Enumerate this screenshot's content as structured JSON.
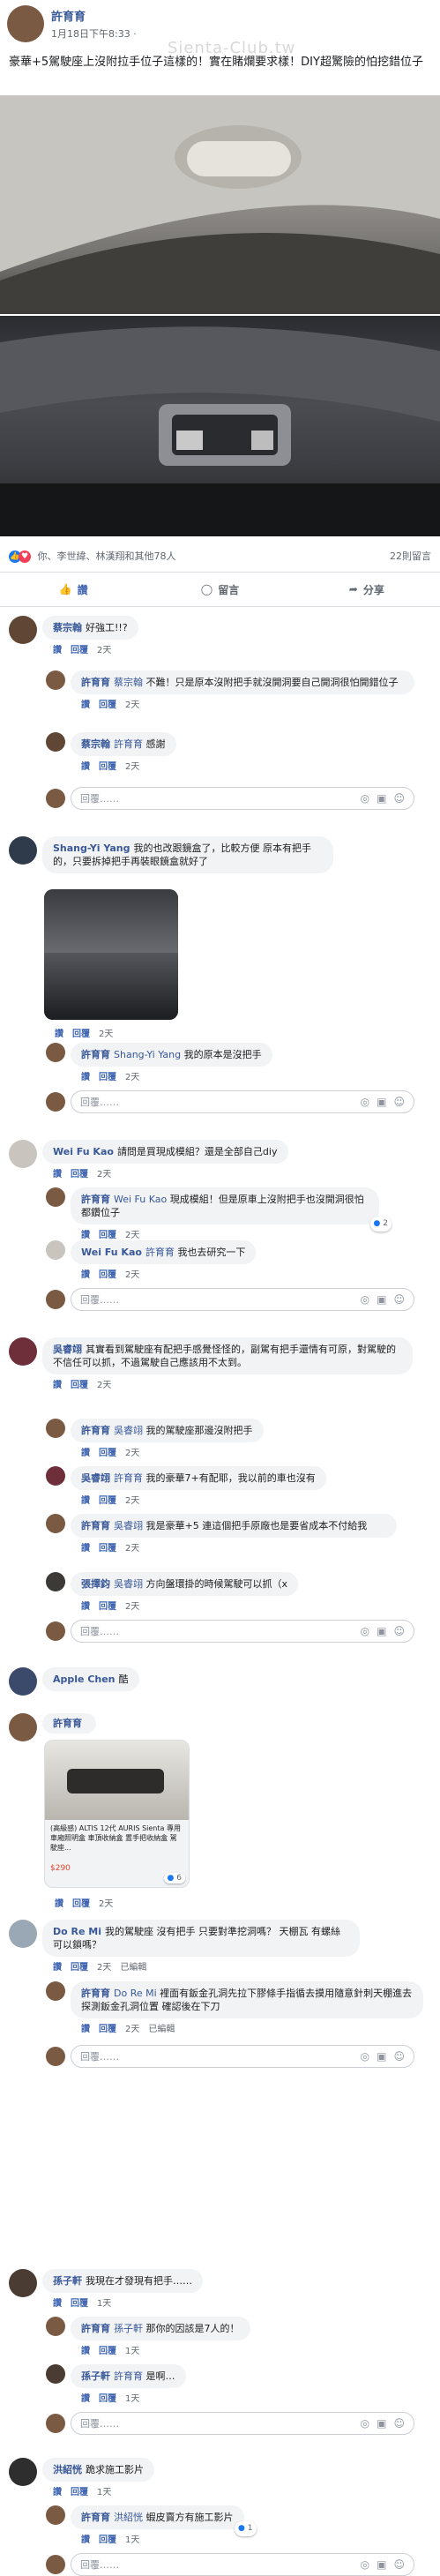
{
  "post": {
    "author": "許育育",
    "time": "1月18日下午8:33",
    "watermark": "Sienta-Club.tw",
    "text": "豪華+5駕駛座上沒附拉手位子這樣的！實在賭爛要求樣！DIY超驚險的怕挖錯位子"
  },
  "reactions": {
    "summary": "你、李世緯、林漢翔和其他78人",
    "comment_count": "22則留言"
  },
  "actions": {
    "like": "讚",
    "comment": "留言",
    "share": "分享"
  },
  "reply_placeholder": "回覆……",
  "comments": {
    "c1": {
      "name": "蔡宗翰",
      "text": "好強工!!?",
      "like": "讚",
      "reply": "回覆",
      "time": "2天",
      "r1": {
        "name": "許育育",
        "mention": "蔡宗翰",
        "text": "不難！只是原本沒附把手就沒開洞要自己開洞很怕開錯位子",
        "time": "2天"
      },
      "r2": {
        "name": "蔡宗翰",
        "mention": "許育育",
        "text": "感謝",
        "time": "2天"
      }
    },
    "c2": {
      "name": "Shang-Yi Yang",
      "text": "我的也改跟鏡盒了，比較方便 原本有把手的，只要拆掉把手再裝眼鏡盒就好了",
      "time": "2天",
      "r1": {
        "name": "許育育",
        "mention": "Shang-Yi Yang",
        "text": "我的原本是沒把手",
        "time": "2天"
      }
    },
    "c3": {
      "name": "Wei Fu Kao",
      "text": "請問是買現成模組？還是全部自己diy",
      "time": "2天",
      "r1": {
        "name": "許育育",
        "mention": "Wei Fu Kao",
        "text": "現成模組！但是原車上沒附把手也沒開洞很怕都鑽位子",
        "time": "2天",
        "badge": "2"
      },
      "r2": {
        "name": "Wei Fu Kao",
        "mention": "許育育",
        "text": "我也去研究一下",
        "time": "2天"
      }
    },
    "c4": {
      "name": "吳睿翊",
      "text": "其實看到駕駛座有配把手感覺怪怪的，副駕有把手還情有可原，對駕駛的不信任可以抓，不過駕駛自己應該用不太到。",
      "time": "2天",
      "r1": {
        "name": "許育育",
        "mention": "吳睿翊",
        "text": "我的駕駛座那邊沒附把手",
        "time": "2天"
      },
      "r2": {
        "name": "吳睿翊",
        "mention": "許育育",
        "text": "我的豪華7+有配耶，我以前的車也沒有",
        "time": "2天"
      },
      "r3": {
        "name": "許育育",
        "mention": "吳睿翊",
        "text": "我是豪華+5 連這個把手原廠也是要省成本不付給我",
        "time": "2天"
      },
      "r4": {
        "name": "張擇鈞",
        "mention": "吳睿翊",
        "text": "方向盤環掛的時候駕駛可以抓（x",
        "time": "2天"
      }
    },
    "c5": {
      "name": "Apple Chen",
      "text": "酷",
      "time": "2天"
    },
    "c6": {
      "name": "許育育",
      "link_title": "(高級感) ALTIS 12代 AURIS Sienta 專用車廂照明盒 車頂收納盒 置手把收納盒 駕駛座...",
      "link_price": "$290",
      "badge": "6",
      "time": "2天"
    },
    "c7": {
      "name": "Do Re Mi",
      "text": "我的駕駛座 沒有把手 只要對準挖洞嗎？ 天棚瓦 有螺絲可以鎖嗎？",
      "time": "2天",
      "edited": "已編輯",
      "r1": {
        "name": "許育育",
        "mention": "Do Re Mi",
        "text": "裡面有鈑金孔洞先拉下膠條手指循去摸用隨意針刺天棚進去探測鈑金孔洞位置 確認後在下刀",
        "time": "2天",
        "edited": "已編輯"
      }
    },
    "c8": {
      "name": "孫子軒",
      "text": "我現在才發現有把手……",
      "time": "1天",
      "r1": {
        "name": "許育育",
        "mention": "孫子軒",
        "text": "那你的因該是7人的！",
        "time": "1天"
      },
      "r2": {
        "name": "孫子軒",
        "mention": "許育育",
        "text": "是啊…",
        "time": "1天"
      }
    },
    "c9": {
      "name": "洪紹恍",
      "text": "跪求施工影片",
      "time": "1天",
      "r1": {
        "name": "許育育",
        "mention": "洪紹恍",
        "text": "蝦皮賣方有施工影片",
        "time": "1天",
        "badge": "1"
      }
    }
  },
  "colors": {
    "link": "#385898",
    "accent": "#4267b2",
    "like_blue": "#1877f2",
    "love_red": "#f33e58"
  }
}
